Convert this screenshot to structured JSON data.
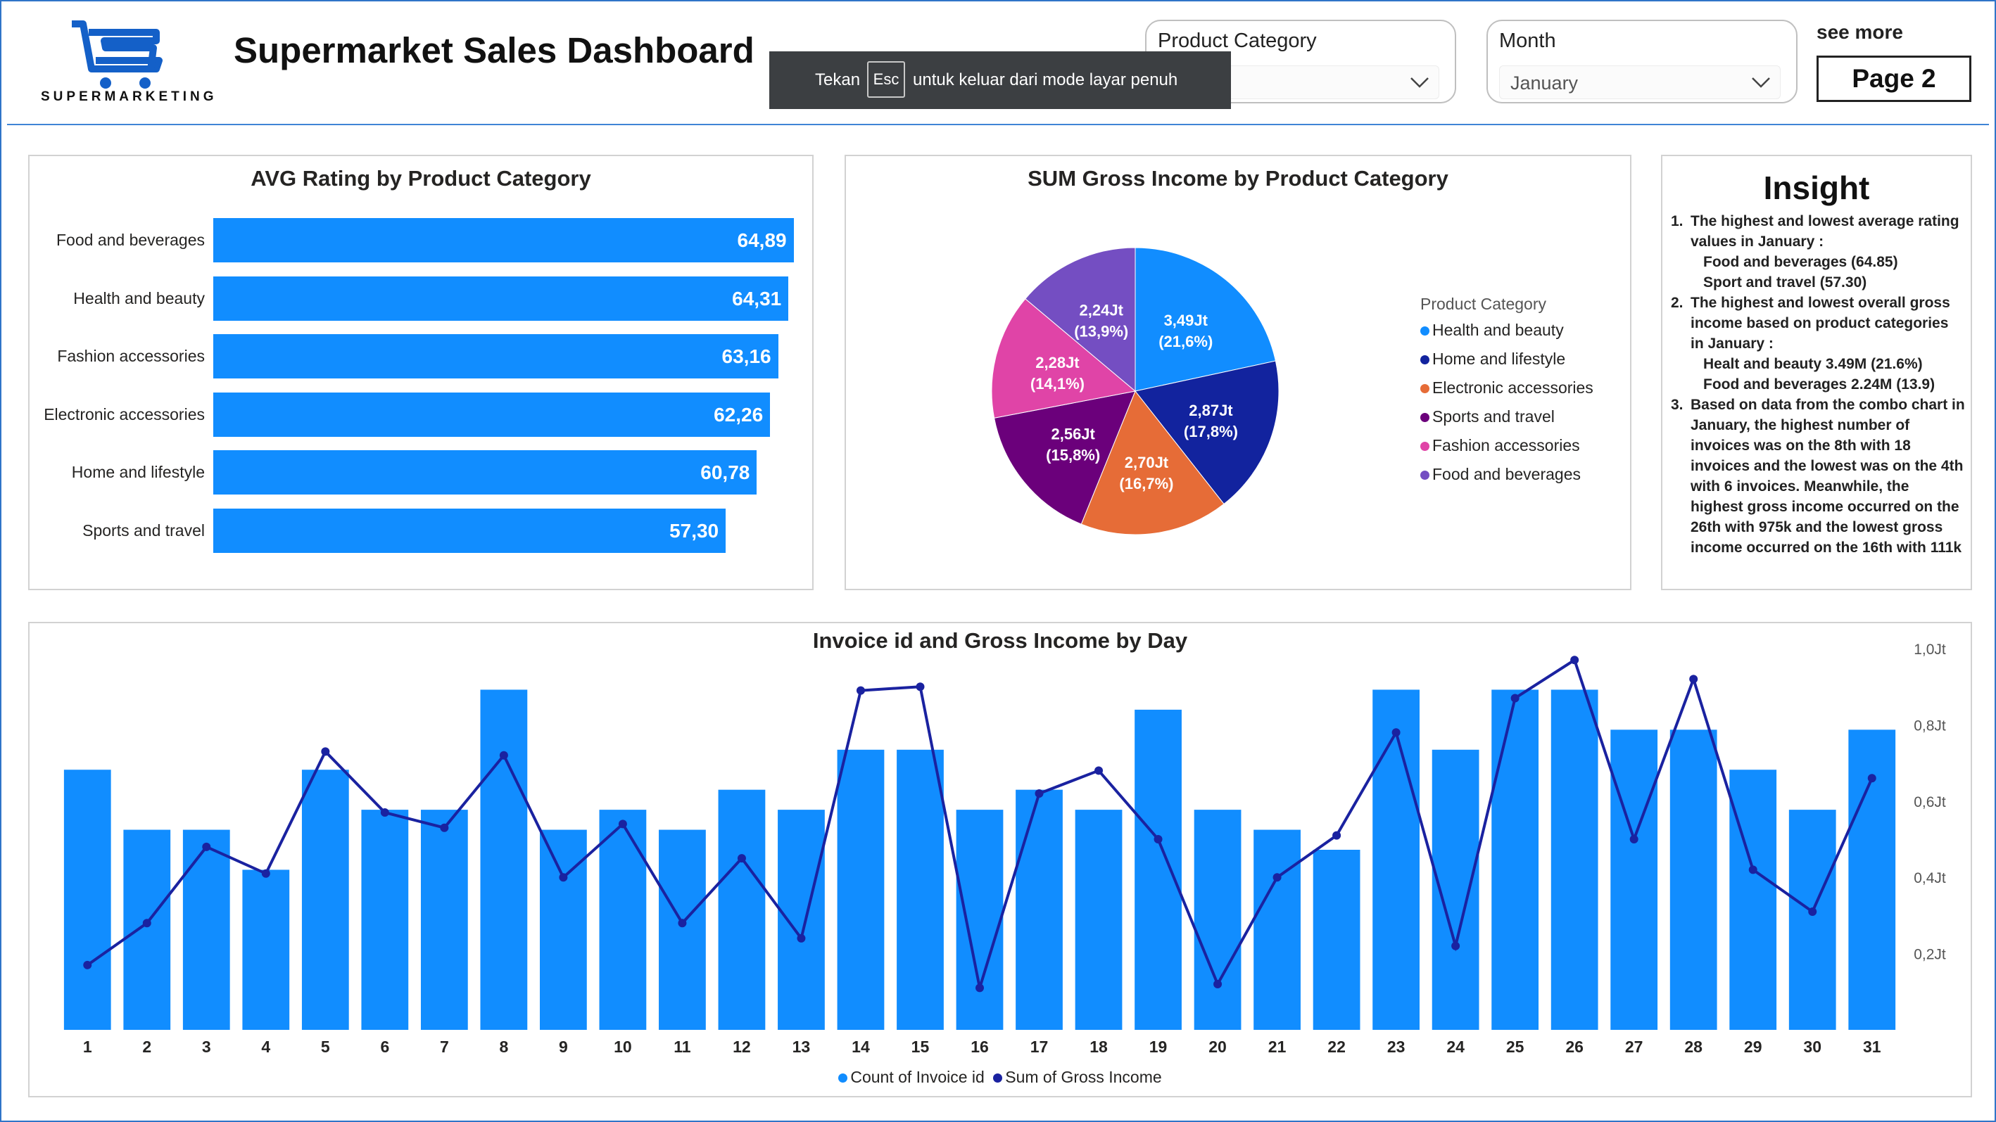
{
  "header": {
    "logo_text": "SUPERMARKETING",
    "title": "Supermarket Sales Dashboard",
    "toast": {
      "prefix": "Tekan",
      "key": "Esc",
      "suffix": "untuk keluar dari mode layar penuh"
    },
    "slicers": [
      {
        "label": "Product Category",
        "value": ""
      },
      {
        "label": "Month",
        "value": "January"
      }
    ],
    "see_more": "see more",
    "page_button": "Page 2"
  },
  "colors": {
    "bar": "#118dff",
    "line": "#1a22a0",
    "pie": [
      "#118dff",
      "#12239e",
      "#e66c37",
      "#6b007b",
      "#e044a7",
      "#744ec2"
    ]
  },
  "chart_data": [
    {
      "type": "bar",
      "title": "AVG Rating by Product Category",
      "categories": [
        "Food and beverages",
        "Health and beauty",
        "Fashion accessories",
        "Electronic accessories",
        "Home and lifestyle",
        "Sports and travel"
      ],
      "values": [
        64.89,
        64.31,
        63.16,
        62.26,
        60.78,
        57.3
      ],
      "value_labels": [
        "64,89",
        "64,31",
        "63,16",
        "62,26",
        "60,78",
        "57,30"
      ],
      "xlim": [
        0,
        65
      ]
    },
    {
      "type": "pie",
      "title": "SUM Gross Income by Product Category",
      "legend_title": "Product Category",
      "legend_position": "right",
      "slices": [
        {
          "name": "Health and beauty",
          "value": 3.49,
          "label": "3,49Jt",
          "pct": "(21,6%)"
        },
        {
          "name": "Home and lifestyle",
          "value": 2.87,
          "label": "2,87Jt",
          "pct": "(17,8%)"
        },
        {
          "name": "Electronic accessories",
          "value": 2.7,
          "label": "2,70Jt",
          "pct": "(16,7%)"
        },
        {
          "name": "Sports and travel",
          "value": 2.56,
          "label": "2,56Jt",
          "pct": "(15,8%)"
        },
        {
          "name": "Fashion accessories",
          "value": 2.28,
          "label": "2,28Jt",
          "pct": "(14,1%)"
        },
        {
          "name": "Food and beverages",
          "value": 2.24,
          "label": "2,24Jt",
          "pct": "(13,9%)"
        }
      ]
    },
    {
      "type": "bar+line",
      "title": "Invoice id and Gross Income by Day",
      "x": [
        1,
        2,
        3,
        4,
        5,
        6,
        7,
        8,
        9,
        10,
        11,
        12,
        13,
        14,
        15,
        16,
        17,
        18,
        19,
        20,
        21,
        22,
        23,
        24,
        25,
        26,
        27,
        28,
        29,
        30,
        31
      ],
      "series": [
        {
          "name": "Count of Invoice id",
          "type": "bar",
          "values": [
            13,
            10,
            10,
            8,
            13,
            11,
            11,
            17,
            10,
            11,
            10,
            12,
            11,
            14,
            14,
            11,
            12,
            11,
            16,
            11,
            10,
            9,
            17,
            14,
            17,
            17,
            15,
            15,
            13,
            11,
            15
          ],
          "ylim": [
            0,
            18
          ]
        },
        {
          "name": "Sum of Gross Income",
          "type": "line",
          "values": [
            0.17,
            0.28,
            0.48,
            0.41,
            0.73,
            0.57,
            0.53,
            0.72,
            0.4,
            0.54,
            0.28,
            0.45,
            0.24,
            0.89,
            0.9,
            0.11,
            0.62,
            0.68,
            0.5,
            0.12,
            0.4,
            0.51,
            0.78,
            0.22,
            0.87,
            0.97,
            0.5,
            0.92,
            0.42,
            0.31,
            0.66
          ],
          "ylim": [
            0,
            1.0
          ]
        }
      ],
      "right_axis_ticks": [
        "1,0Jt",
        "0,8Jt",
        "0,6Jt",
        "0,4Jt",
        "0,2Jt"
      ],
      "right_axis_values": [
        1.0,
        0.8,
        0.6,
        0.4,
        0.2
      ]
    }
  ],
  "insight": {
    "title": "Insight",
    "items": [
      {
        "num": "1.",
        "text": "The highest and lowest average rating values in January :",
        "sub": [
          "Food and beverages (64.85)",
          "Sport and travel (57.30)"
        ]
      },
      {
        "num": "2.",
        "text": "The highest and lowest overall gross income based on product categories in January :",
        "sub": [
          "Healt and beauty 3.49M (21.6%)",
          "Food and beverages 2.24M (13.9)"
        ]
      },
      {
        "num": "3.",
        "text": "Based on data from the combo chart in January, the highest number of invoices was on the 8th with 18 invoices and the lowest was on the 4th with 6 invoices. Meanwhile, the highest gross income occurred on the 26th with 975k and the lowest gross income occurred on the 16th with 111k",
        "sub": []
      }
    ]
  }
}
